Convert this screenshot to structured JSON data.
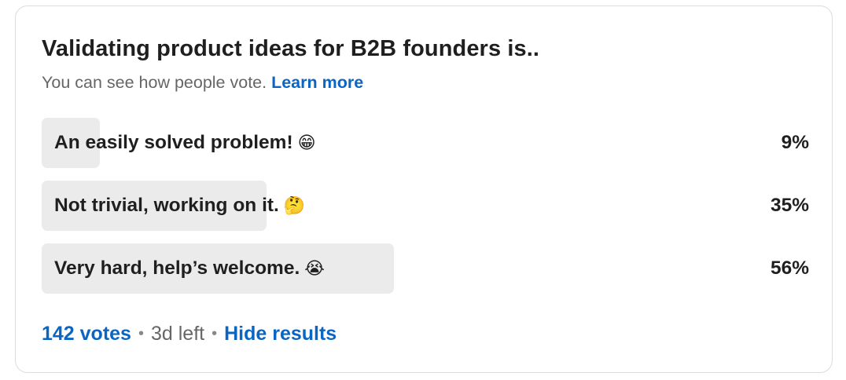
{
  "poll": {
    "question": "Validating product ideas for B2B founders is..",
    "visibility_text": "You can see how people vote.",
    "learn_more": "Learn more",
    "options": [
      {
        "label": "An easily solved problem!",
        "emoji": "😁",
        "percent_label": "9%",
        "percent": 9
      },
      {
        "label": "Not trivial, working on it.",
        "emoji": "🤔",
        "percent_label": "35%",
        "percent": 35
      },
      {
        "label": "Very hard, help’s welcome.",
        "emoji": "😭",
        "percent_label": "56%",
        "percent": 56
      }
    ],
    "votes": "142 votes",
    "time_left": "3d left",
    "separator": "•",
    "hide_results": "Hide results"
  },
  "colors": {
    "link": "#0a66c2",
    "bar": "#ebebeb",
    "text": "#1f1f1f",
    "muted": "#666666"
  }
}
